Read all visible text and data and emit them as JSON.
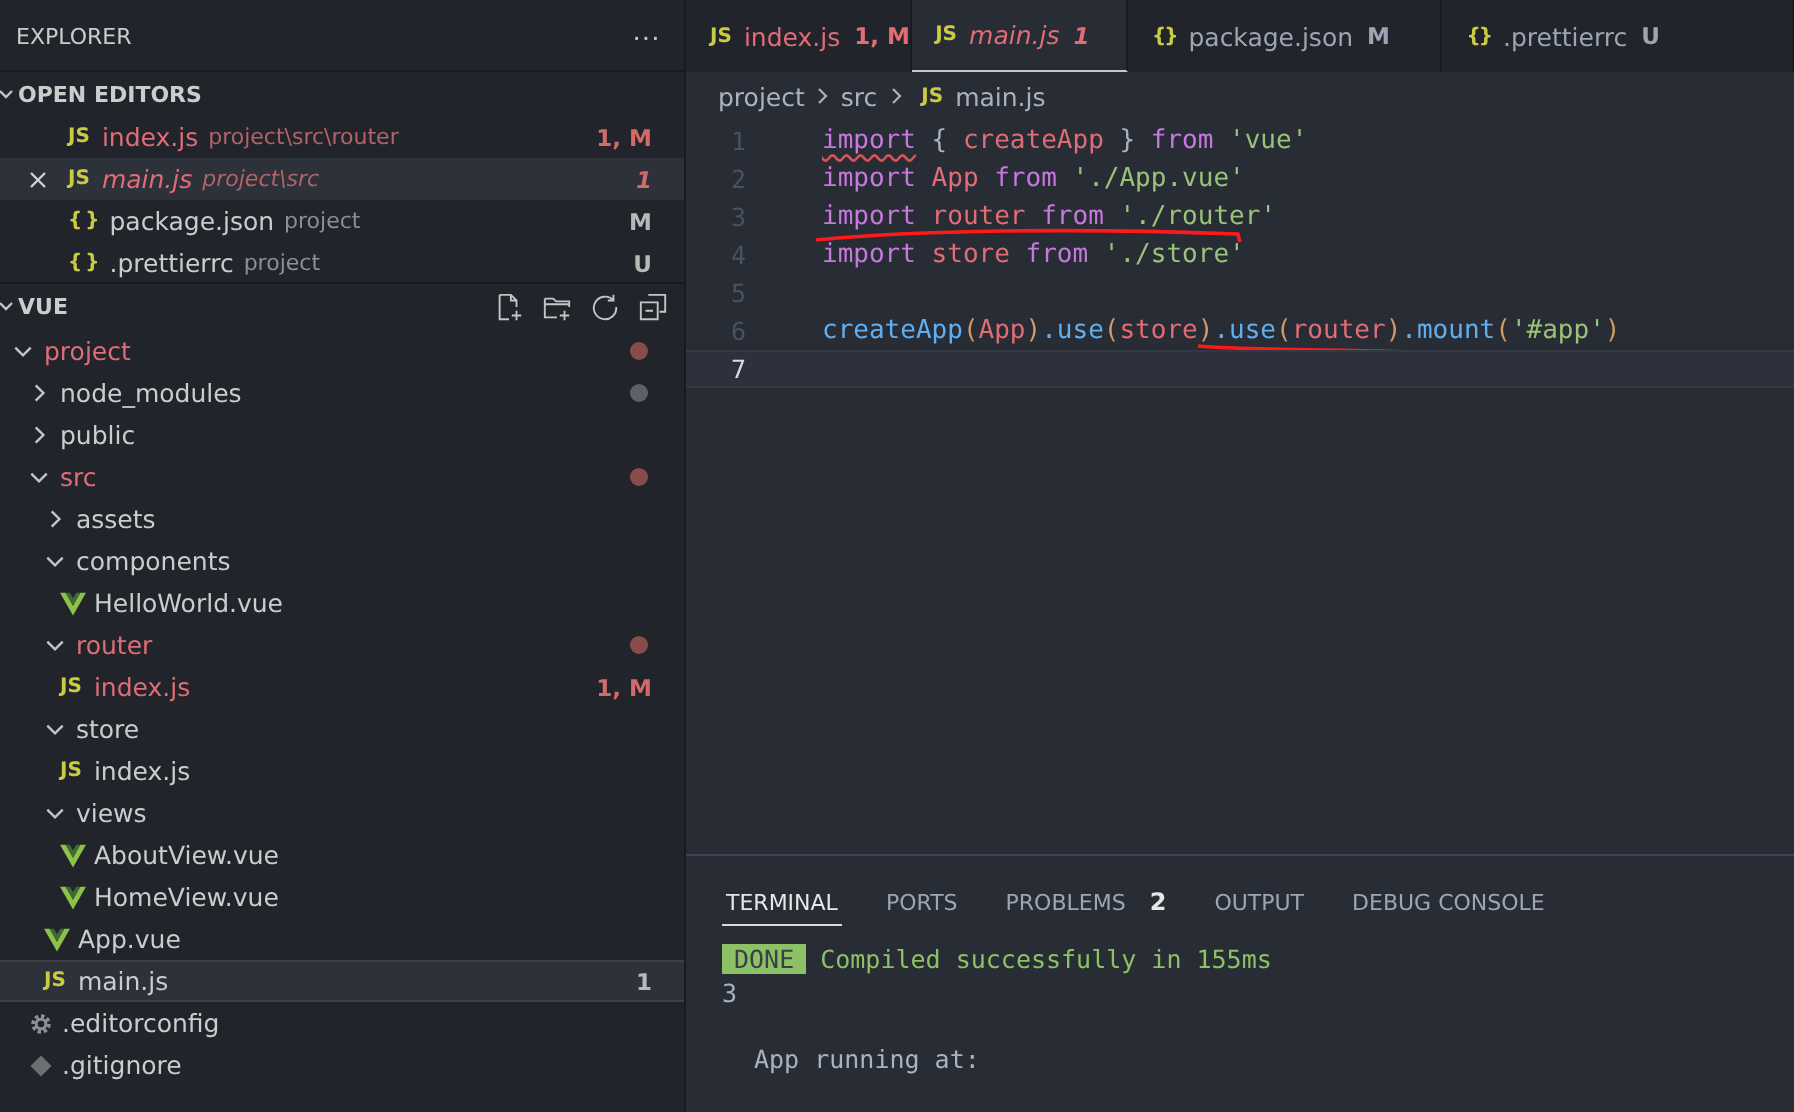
{
  "sidebar": {
    "title": "EXPLORER",
    "more": "···",
    "open_editors": {
      "title": "OPEN EDITORS",
      "expanded": true,
      "items": [
        {
          "icon_text": "JS",
          "kind": "js",
          "name": "index.js",
          "path": "project\\src\\router",
          "badge": "1, M",
          "modified": true,
          "preview": false,
          "selected": false
        },
        {
          "icon_text": "JS",
          "kind": "js",
          "name": "main.js",
          "path": "project\\src",
          "badge": "1",
          "modified": true,
          "preview": true,
          "selected": true
        },
        {
          "icon_text": "{ }",
          "kind": "json",
          "name": "package.json",
          "path": "project",
          "badge": "M",
          "modified": false,
          "preview": false,
          "selected": false
        },
        {
          "icon_text": "{ }",
          "kind": "json",
          "name": ".prettierrc",
          "path": "project",
          "badge": "U",
          "modified": false,
          "preview": false,
          "selected": false
        }
      ]
    },
    "workspace": {
      "title": "VUE",
      "expanded": true,
      "tree": [
        {
          "name": "project",
          "kind": "folder",
          "expanded": true,
          "modified": true,
          "color": "#8a4b4b",
          "children": [
            {
              "name": "node_modules",
              "kind": "folder",
              "expanded": false,
              "modified": false,
              "color": "#5d6169"
            },
            {
              "name": "public",
              "kind": "folder",
              "expanded": false,
              "modified": false
            },
            {
              "name": "src",
              "kind": "folder",
              "expanded": true,
              "modified": true,
              "color": "#8a4b4b",
              "children": [
                {
                  "name": "assets",
                  "kind": "folder",
                  "expanded": false,
                  "modified": false
                },
                {
                  "name": "components",
                  "kind": "folder",
                  "expanded": true,
                  "modified": false,
                  "children": [
                    {
                      "name": "HelloWorld.vue",
                      "kind": "vue",
                      "modified": false
                    }
                  ]
                },
                {
                  "name": "router",
                  "kind": "folder",
                  "expanded": true,
                  "modified": true,
                  "color": "#8a4b4b",
                  "children": [
                    {
                      "name": "index.js",
                      "kind": "js",
                      "icon_text": "JS",
                      "modified": true,
                      "badge": "1, M"
                    }
                  ]
                },
                {
                  "name": "store",
                  "kind": "folder",
                  "expanded": true,
                  "modified": false,
                  "children": [
                    {
                      "name": "index.js",
                      "kind": "js",
                      "icon_text": "JS",
                      "modified": false
                    }
                  ]
                },
                {
                  "name": "views",
                  "kind": "folder",
                  "expanded": true,
                  "modified": false,
                  "children": [
                    {
                      "name": "AboutView.vue",
                      "kind": "vue",
                      "modified": false
                    },
                    {
                      "name": "HomeView.vue",
                      "kind": "vue",
                      "modified": false
                    }
                  ]
                },
                {
                  "name": "App.vue",
                  "kind": "vue",
                  "modified": false
                },
                {
                  "name": "main.js",
                  "kind": "js",
                  "icon_text": "JS",
                  "modified": false,
                  "badge": "1",
                  "selected": true
                }
              ]
            },
            {
              "name": ".editorconfig",
              "kind": "gear",
              "modified": false
            },
            {
              "name": ".gitignore",
              "kind": "diamond",
              "modified": false
            }
          ]
        }
      ]
    }
  },
  "tabs": [
    {
      "icon_text": "JS",
      "kind": "js",
      "label": "index.js",
      "badge": "1, M",
      "modified": true,
      "preview": false,
      "selected": false
    },
    {
      "icon_text": "JS",
      "kind": "js",
      "label": "main.js",
      "badge": "1",
      "modified": true,
      "preview": true,
      "selected": true
    },
    {
      "icon_text": "{}",
      "kind": "json",
      "label": "package.json",
      "badge": "M",
      "modified": false,
      "preview": false,
      "selected": false
    },
    {
      "icon_text": "{}",
      "kind": "json",
      "label": ".prettierrc",
      "badge": "U",
      "modified": false,
      "preview": false,
      "selected": false
    }
  ],
  "breadcrumb": [
    {
      "label": "project"
    },
    {
      "label": "src"
    },
    {
      "label": "main.js",
      "icon_text": "JS"
    }
  ],
  "code": [
    {
      "number": "1",
      "tokens": [
        {
          "kind": "keyword",
          "text": "import",
          "error": true
        },
        {
          "kind": "punct",
          "text": " { "
        },
        {
          "kind": "variable",
          "text": "createApp"
        },
        {
          "kind": "punct",
          "text": " } "
        },
        {
          "kind": "keyword",
          "text": "from"
        },
        {
          "kind": "string",
          "text": " 'vue'"
        }
      ]
    },
    {
      "number": "2",
      "tokens": [
        {
          "kind": "keyword",
          "text": "import"
        },
        {
          "kind": "variable",
          "text": " App "
        },
        {
          "kind": "keyword",
          "text": "from"
        },
        {
          "kind": "string",
          "text": " './App.vue'"
        }
      ]
    },
    {
      "number": "3",
      "tokens": [
        {
          "kind": "keyword",
          "text": "import"
        },
        {
          "kind": "variable",
          "text": " router "
        },
        {
          "kind": "keyword",
          "text": "from"
        },
        {
          "kind": "string",
          "text": " './router'"
        }
      ],
      "underline": true
    },
    {
      "number": "4",
      "tokens": [
        {
          "kind": "keyword",
          "text": "import"
        },
        {
          "kind": "variable",
          "text": " store "
        },
        {
          "kind": "keyword",
          "text": "from"
        },
        {
          "kind": "string",
          "text": " './store'"
        }
      ]
    },
    {
      "number": "5"
    },
    {
      "number": "6",
      "tokens": [
        {
          "kind": "function",
          "text": "createApp"
        },
        {
          "kind": "paren",
          "text": "("
        },
        {
          "kind": "variable",
          "text": "App"
        },
        {
          "kind": "paren",
          "text": ")"
        },
        {
          "kind": "function",
          "text": ".use"
        },
        {
          "kind": "paren",
          "text": "("
        },
        {
          "kind": "variable",
          "text": "store"
        },
        {
          "kind": "paren",
          "text": ")"
        },
        {
          "kind": "function",
          "text": ".use"
        },
        {
          "kind": "paren",
          "text": "("
        },
        {
          "kind": "variable",
          "text": "router"
        },
        {
          "kind": "paren",
          "text": ")"
        },
        {
          "kind": "function",
          "text": ".mount"
        },
        {
          "kind": "paren",
          "text": "("
        },
        {
          "kind": "string",
          "text": "'#app'"
        },
        {
          "kind": "paren",
          "text": ")"
        }
      ],
      "underline_tail": true
    },
    {
      "number": "7",
      "current": true
    }
  ],
  "panel": {
    "tabs": [
      {
        "label": "TERMINAL",
        "selected": true
      },
      {
        "label": "PORTS",
        "selected": false
      },
      {
        "label": "PROBLEMS",
        "count": "2",
        "selected": false
      },
      {
        "label": "OUTPUT",
        "selected": false
      },
      {
        "label": "DEBUG CONSOLE",
        "selected": false
      }
    ],
    "lines": [
      {
        "kind": "status",
        "badge": "DONE",
        "text": "Compiled successfully in 155ms"
      },
      {
        "kind": "plain",
        "text": "3"
      },
      {
        "kind": "spaced",
        "text": "App running at:"
      }
    ]
  }
}
